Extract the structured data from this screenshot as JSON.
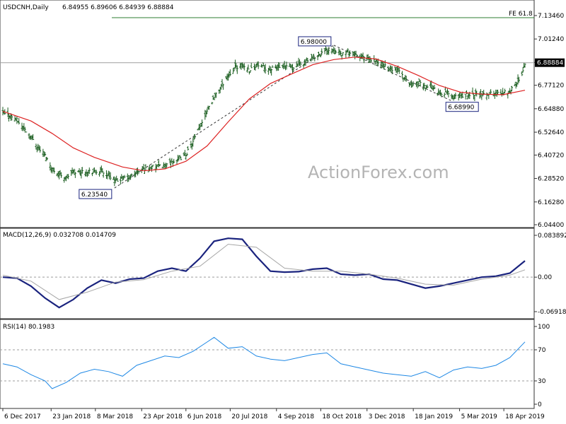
{
  "chart_data": [
    {
      "type": "ohlc",
      "title": "USDCNH,Daily",
      "ohlc_readout": "6.84955 6.89606 6.84939 6.88884",
      "watermark": "ActionForex.com",
      "y_ticks": [
        "7.13460",
        "7.01240",
        "6.89020",
        "6.77120",
        "6.64880",
        "6.52640",
        "6.40720",
        "6.28520",
        "6.16280",
        "6.04400"
      ],
      "ylim": [
        6.044,
        7.1346
      ],
      "current_price": "6.88884",
      "x_ticks": [
        "6 Dec 2017",
        "23 Jan 2018",
        "8 Mar 2018",
        "23 Apr 2018",
        "6 Jun 2018",
        "20 Jul 2018",
        "4 Sep 2018",
        "18 Oct 2018",
        "3 Dec 2018",
        "18 Jan 2019",
        "5 Mar 2019",
        "18 Apr 2019"
      ],
      "annotations": [
        {
          "text": "6.98000",
          "date": "2018-10-31",
          "value": 6.98
        },
        {
          "text": "6.68990",
          "date": "2019-02-25",
          "value": 6.6899
        },
        {
          "text": "6.23540",
          "date": "2018-03-27",
          "value": 6.2354
        }
      ],
      "fibo_label": "FE 61.8",
      "fibo_level": 7.1234,
      "ma_color": "#dd2222",
      "bar_color": "#1b5e20",
      "close_series": [
        [
          "2017-12-06",
          6.622
        ],
        [
          "2017-12-13",
          6.615
        ],
        [
          "2017-12-20",
          6.588
        ],
        [
          "2017-12-27",
          6.545
        ],
        [
          "2018-01-03",
          6.505
        ],
        [
          "2018-01-10",
          6.448
        ],
        [
          "2018-01-17",
          6.405
        ],
        [
          "2018-01-24",
          6.335
        ],
        [
          "2018-01-31",
          6.31
        ],
        [
          "2018-02-07",
          6.288
        ],
        [
          "2018-02-14",
          6.322
        ],
        [
          "2018-02-21",
          6.318
        ],
        [
          "2018-02-28",
          6.325
        ],
        [
          "2018-03-07",
          6.318
        ],
        [
          "2018-03-14",
          6.325
        ],
        [
          "2018-03-21",
          6.305
        ],
        [
          "2018-03-28",
          6.27
        ],
        [
          "2018-04-04",
          6.285
        ],
        [
          "2018-04-11",
          6.293
        ],
        [
          "2018-04-18",
          6.318
        ],
        [
          "2018-04-25",
          6.335
        ],
        [
          "2018-05-02",
          6.342
        ],
        [
          "2018-05-09",
          6.35
        ],
        [
          "2018-05-16",
          6.348
        ],
        [
          "2018-05-23",
          6.373
        ],
        [
          "2018-05-30",
          6.385
        ],
        [
          "2018-06-06",
          6.41
        ],
        [
          "2018-06-13",
          6.475
        ],
        [
          "2018-06-20",
          6.555
        ],
        [
          "2018-06-27",
          6.642
        ],
        [
          "2018-07-04",
          6.705
        ],
        [
          "2018-07-11",
          6.765
        ],
        [
          "2018-07-18",
          6.825
        ],
        [
          "2018-07-25",
          6.865
        ],
        [
          "2018-08-01",
          6.875
        ],
        [
          "2018-08-08",
          6.85
        ],
        [
          "2018-08-15",
          6.878
        ],
        [
          "2018-08-22",
          6.863
        ],
        [
          "2018-08-29",
          6.853
        ],
        [
          "2018-09-05",
          6.865
        ],
        [
          "2018-09-12",
          6.862
        ],
        [
          "2018-09-19",
          6.868
        ],
        [
          "2018-09-26",
          6.877
        ],
        [
          "2018-10-03",
          6.892
        ],
        [
          "2018-10-10",
          6.91
        ],
        [
          "2018-10-17",
          6.935
        ],
        [
          "2018-10-24",
          6.955
        ],
        [
          "2018-10-31",
          6.962
        ],
        [
          "2018-11-07",
          6.933
        ],
        [
          "2018-11-14",
          6.945
        ],
        [
          "2018-11-21",
          6.928
        ],
        [
          "2018-11-28",
          6.918
        ],
        [
          "2018-12-05",
          6.905
        ],
        [
          "2018-12-12",
          6.893
        ],
        [
          "2018-12-19",
          6.88
        ],
        [
          "2018-12-26",
          6.85
        ],
        [
          "2019-01-02",
          6.855
        ],
        [
          "2019-01-09",
          6.81
        ],
        [
          "2019-01-16",
          6.775
        ],
        [
          "2019-01-23",
          6.783
        ],
        [
          "2019-01-30",
          6.765
        ],
        [
          "2019-02-06",
          6.762
        ],
        [
          "2019-02-13",
          6.725
        ],
        [
          "2019-02-20",
          6.735
        ],
        [
          "2019-02-27",
          6.708
        ],
        [
          "2019-03-06",
          6.715
        ],
        [
          "2019-03-13",
          6.722
        ],
        [
          "2019-03-20",
          6.728
        ],
        [
          "2019-03-27",
          6.718
        ],
        [
          "2019-04-03",
          6.73
        ],
        [
          "2019-04-10",
          6.725
        ],
        [
          "2019-04-17",
          6.735
        ],
        [
          "2019-04-24",
          6.742
        ],
        [
          "2019-05-01",
          6.78
        ],
        [
          "2019-05-06",
          6.835
        ],
        [
          "2019-05-09",
          6.889
        ]
      ],
      "ma_series": [
        [
          "2017-12-06",
          6.635
        ],
        [
          "2018-01-03",
          6.585
        ],
        [
          "2018-01-24",
          6.52
        ],
        [
          "2018-02-14",
          6.445
        ],
        [
          "2018-03-07",
          6.395
        ],
        [
          "2018-04-04",
          6.345
        ],
        [
          "2018-04-25",
          6.325
        ],
        [
          "2018-05-16",
          6.335
        ],
        [
          "2018-06-06",
          6.375
        ],
        [
          "2018-06-27",
          6.455
        ],
        [
          "2018-07-18",
          6.58
        ],
        [
          "2018-08-08",
          6.7
        ],
        [
          "2018-08-29",
          6.78
        ],
        [
          "2018-09-19",
          6.83
        ],
        [
          "2018-10-10",
          6.878
        ],
        [
          "2018-10-31",
          6.905
        ],
        [
          "2018-11-21",
          6.918
        ],
        [
          "2018-12-12",
          6.908
        ],
        [
          "2019-01-02",
          6.87
        ],
        [
          "2019-01-23",
          6.822
        ],
        [
          "2019-02-13",
          6.77
        ],
        [
          "2019-03-06",
          6.735
        ],
        [
          "2019-03-27",
          6.725
        ],
        [
          "2019-04-17",
          6.722
        ],
        [
          "2019-05-09",
          6.745
        ]
      ],
      "trend_lines": [
        [
          [
            "2018-03-27",
            6.2354
          ],
          [
            "2018-10-31",
            6.98
          ]
        ],
        [
          [
            "2018-10-31",
            6.98
          ],
          [
            "2019-02-25",
            6.6899
          ]
        ]
      ]
    },
    {
      "type": "line",
      "title": "MACD(12,26,9) 0.032708 0.014709",
      "y_ticks": [
        "0.083892",
        "0.00",
        "-0.069189"
      ],
      "ylim": [
        -0.069189,
        0.083892
      ],
      "baseline": 0,
      "series": [
        {
          "role": "macd",
          "color": "#1a237e",
          "points": [
            [
              "2017-12-06",
              0.0
            ],
            [
              "2017-12-20",
              -0.002
            ],
            [
              "2018-01-03",
              -0.018
            ],
            [
              "2018-01-17",
              -0.042
            ],
            [
              "2018-01-31",
              -0.061
            ],
            [
              "2018-02-14",
              -0.045
            ],
            [
              "2018-02-28",
              -0.022
            ],
            [
              "2018-03-14",
              -0.006
            ],
            [
              "2018-03-28",
              -0.012
            ],
            [
              "2018-04-11",
              -0.004
            ],
            [
              "2018-04-25",
              -0.002
            ],
            [
              "2018-05-09",
              0.012
            ],
            [
              "2018-05-23",
              0.018
            ],
            [
              "2018-06-06",
              0.012
            ],
            [
              "2018-06-20",
              0.038
            ],
            [
              "2018-07-04",
              0.072
            ],
            [
              "2018-07-18",
              0.078
            ],
            [
              "2018-08-01",
              0.076
            ],
            [
              "2018-08-15",
              0.042
            ],
            [
              "2018-08-29",
              0.012
            ],
            [
              "2018-09-12",
              0.01
            ],
            [
              "2018-09-26",
              0.011
            ],
            [
              "2018-10-10",
              0.016
            ],
            [
              "2018-10-24",
              0.018
            ],
            [
              "2018-11-07",
              0.006
            ],
            [
              "2018-11-21",
              0.004
            ],
            [
              "2018-12-05",
              0.006
            ],
            [
              "2018-12-19",
              -0.004
            ],
            [
              "2019-01-02",
              -0.006
            ],
            [
              "2019-01-16",
              -0.014
            ],
            [
              "2019-01-30",
              -0.022
            ],
            [
              "2019-02-13",
              -0.018
            ],
            [
              "2019-02-27",
              -0.012
            ],
            [
              "2019-03-13",
              -0.006
            ],
            [
              "2019-03-27",
              0.0
            ],
            [
              "2019-04-10",
              0.002
            ],
            [
              "2019-04-24",
              0.008
            ],
            [
              "2019-05-09",
              0.032708
            ]
          ]
        },
        {
          "role": "signal",
          "color": "#a6a6a6",
          "points": [
            [
              "2017-12-06",
              0.004
            ],
            [
              "2018-01-03",
              -0.008
            ],
            [
              "2018-01-31",
              -0.045
            ],
            [
              "2018-02-28",
              -0.03
            ],
            [
              "2018-03-28",
              -0.01
            ],
            [
              "2018-04-25",
              -0.005
            ],
            [
              "2018-05-23",
              0.012
            ],
            [
              "2018-06-20",
              0.022
            ],
            [
              "2018-07-18",
              0.066
            ],
            [
              "2018-08-15",
              0.06
            ],
            [
              "2018-09-12",
              0.018
            ],
            [
              "2018-10-10",
              0.012
            ],
            [
              "2018-11-07",
              0.012
            ],
            [
              "2018-12-05",
              0.006
            ],
            [
              "2019-01-02",
              -0.002
            ],
            [
              "2019-01-30",
              -0.014
            ],
            [
              "2019-02-27",
              -0.016
            ],
            [
              "2019-03-27",
              -0.004
            ],
            [
              "2019-04-24",
              0.004
            ],
            [
              "2019-05-09",
              0.014709
            ]
          ]
        }
      ]
    },
    {
      "type": "line",
      "title": "RSI(14) 80.1983",
      "y_ticks": [
        "100",
        "70",
        "30",
        "0"
      ],
      "ylim": [
        0,
        100
      ],
      "levels": [
        70,
        30
      ],
      "series": [
        {
          "role": "rsi",
          "color": "#1e88e5",
          "points": [
            [
              "2017-12-06",
              52
            ],
            [
              "2017-12-20",
              48
            ],
            [
              "2018-01-03",
              38
            ],
            [
              "2018-01-17",
              30
            ],
            [
              "2018-01-24",
              20
            ],
            [
              "2018-02-07",
              28
            ],
            [
              "2018-02-21",
              40
            ],
            [
              "2018-03-07",
              45
            ],
            [
              "2018-03-21",
              42
            ],
            [
              "2018-04-04",
              36
            ],
            [
              "2018-04-18",
              50
            ],
            [
              "2018-05-02",
              56
            ],
            [
              "2018-05-16",
              62
            ],
            [
              "2018-05-30",
              60
            ],
            [
              "2018-06-13",
              68
            ],
            [
              "2018-06-27",
              80
            ],
            [
              "2018-07-04",
              86
            ],
            [
              "2018-07-18",
              72
            ],
            [
              "2018-08-01",
              74
            ],
            [
              "2018-08-15",
              62
            ],
            [
              "2018-08-29",
              58
            ],
            [
              "2018-09-12",
              56
            ],
            [
              "2018-09-26",
              60
            ],
            [
              "2018-10-10",
              64
            ],
            [
              "2018-10-24",
              66
            ],
            [
              "2018-11-07",
              52
            ],
            [
              "2018-11-21",
              48
            ],
            [
              "2018-12-05",
              44
            ],
            [
              "2018-12-19",
              40
            ],
            [
              "2019-01-02",
              38
            ],
            [
              "2019-01-16",
              36
            ],
            [
              "2019-01-30",
              42
            ],
            [
              "2019-02-13",
              34
            ],
            [
              "2019-02-27",
              44
            ],
            [
              "2019-03-13",
              48
            ],
            [
              "2019-03-27",
              46
            ],
            [
              "2019-04-10",
              50
            ],
            [
              "2019-04-24",
              60
            ],
            [
              "2019-05-09",
              80.1983
            ]
          ]
        }
      ]
    }
  ]
}
